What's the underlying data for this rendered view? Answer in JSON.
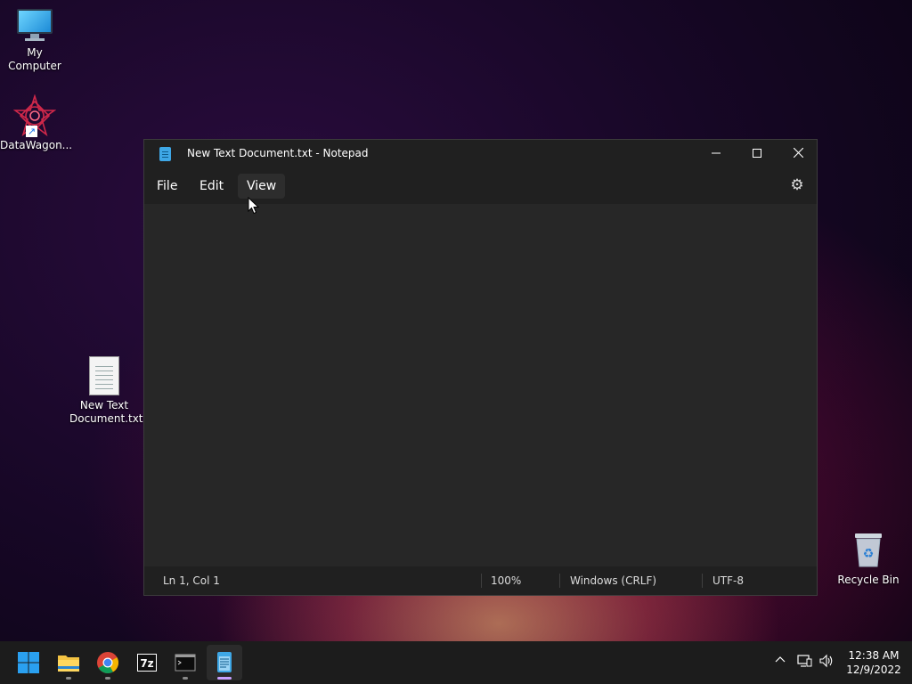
{
  "desktop": {
    "icons": [
      {
        "label": "My Computer"
      },
      {
        "label": "DataWagon..."
      },
      {
        "label": "New Text\nDocument.txt"
      },
      {
        "label": "Recycle Bin"
      }
    ]
  },
  "notepad": {
    "title": "New Text Document.txt - Notepad",
    "menu": {
      "file": "File",
      "edit": "Edit",
      "view": "View"
    },
    "content": "",
    "status": {
      "position": "Ln 1, Col 1",
      "zoom": "100%",
      "line_ending": "Windows (CRLF)",
      "encoding": "UTF-8"
    }
  },
  "taskbar": {
    "apps": [
      "start-icon",
      "file-explorer-icon",
      "chrome-icon",
      "7zip-icon",
      "terminal-icon",
      "notepad-icon"
    ],
    "active_app": "notepad-icon",
    "clock": {
      "time": "12:38 AM",
      "date": "12/9/2022"
    }
  },
  "colors": {
    "window_bg": "#272727",
    "titlebar_bg": "#202020",
    "taskbar_bg": "#1c1c1c",
    "active_indicator": "#c8a0ff"
  }
}
